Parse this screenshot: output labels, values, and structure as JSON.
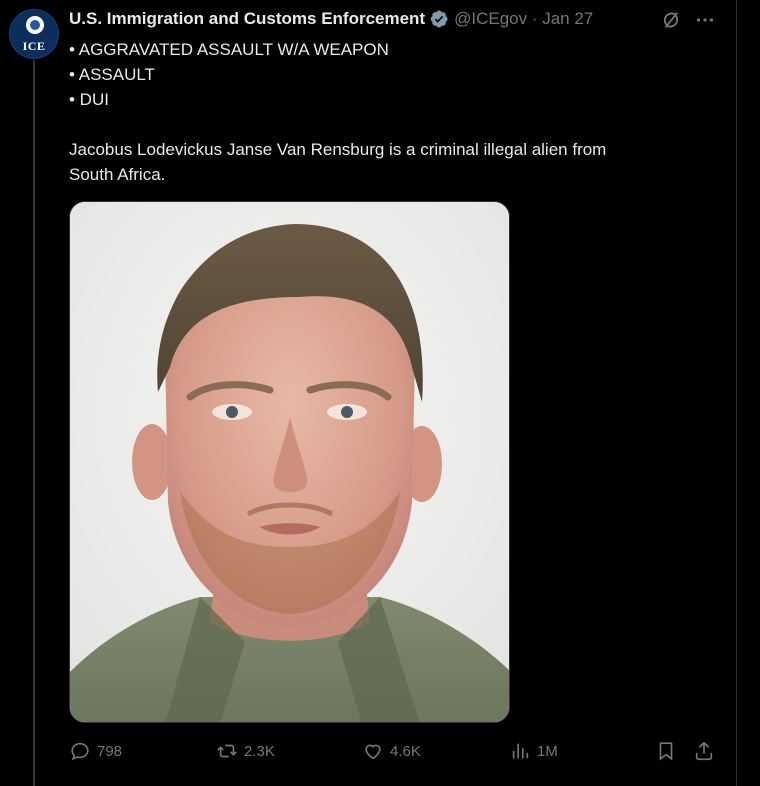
{
  "post": {
    "author": {
      "display_name": "U.S. Immigration and Customs Enforcement",
      "handle_date": "@ICEgov · Jan 27",
      "avatar_text": "ICE"
    },
    "body": {
      "bullets": [
        "• AGGRAVATED ASSAULT W/A WEAPON",
        "• ASSAULT",
        "• DUI"
      ],
      "paragraph_lines": [
        "Jacobus Lodevickus Janse Van Rensburg is a criminal illegal alien from",
        "South Africa."
      ]
    },
    "actions": {
      "replies": "798",
      "reposts": "2.3K",
      "likes": "4.6K",
      "views": "1M"
    }
  },
  "colors": {
    "background": "#000000",
    "text": "#e7e9ea",
    "secondary": "#71767b",
    "verified": "#829aab",
    "divider": "#2f3336"
  },
  "icons": [
    "verified-badge-icon",
    "grok-icon",
    "more-icon",
    "reply-icon",
    "repost-icon",
    "like-icon",
    "views-icon",
    "bookmark-icon",
    "share-icon"
  ]
}
